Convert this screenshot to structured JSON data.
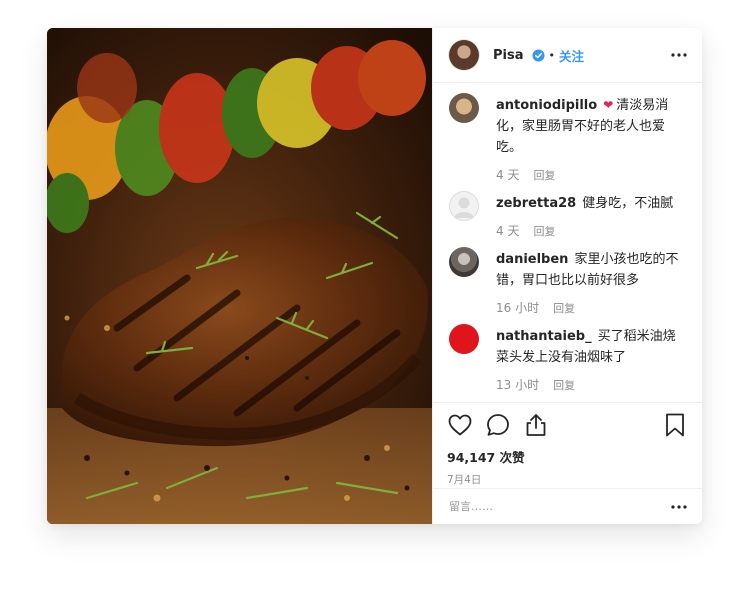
{
  "post": {
    "username": "Pisa",
    "separator": "•",
    "follow_label": "关注",
    "likes_text": "94,147 次赞",
    "date_text": "7月4日"
  },
  "comments": [
    {
      "user": "antoniodipillo",
      "emoji": "❤",
      "text": "清淡易消化，家里肠胃不好的老人也爱吃。",
      "time": "4 天",
      "reply": "回复"
    },
    {
      "user": "zebretta28",
      "text": "健身吃，不油腻",
      "time": "4 天",
      "reply": "回复"
    },
    {
      "user": "danielben",
      "text": "家里小孩也吃的不错，胃口也比以前好很多",
      "time": "16 小时",
      "reply": "回复"
    },
    {
      "user": "nathantaieb_",
      "text": "买了稻米油烧菜头发上没有油烟味了",
      "time": "13 小时",
      "reply": "回复"
    }
  ],
  "add_comment": {
    "placeholder": "留言……"
  },
  "colors": {
    "accent": "#3897f0",
    "heart": "#e0245e",
    "avatar_red": "#e0141b"
  },
  "icons": [
    "verified-badge-icon",
    "more-options-icon",
    "heart-icon",
    "comment-icon",
    "share-icon",
    "bookmark-icon"
  ]
}
